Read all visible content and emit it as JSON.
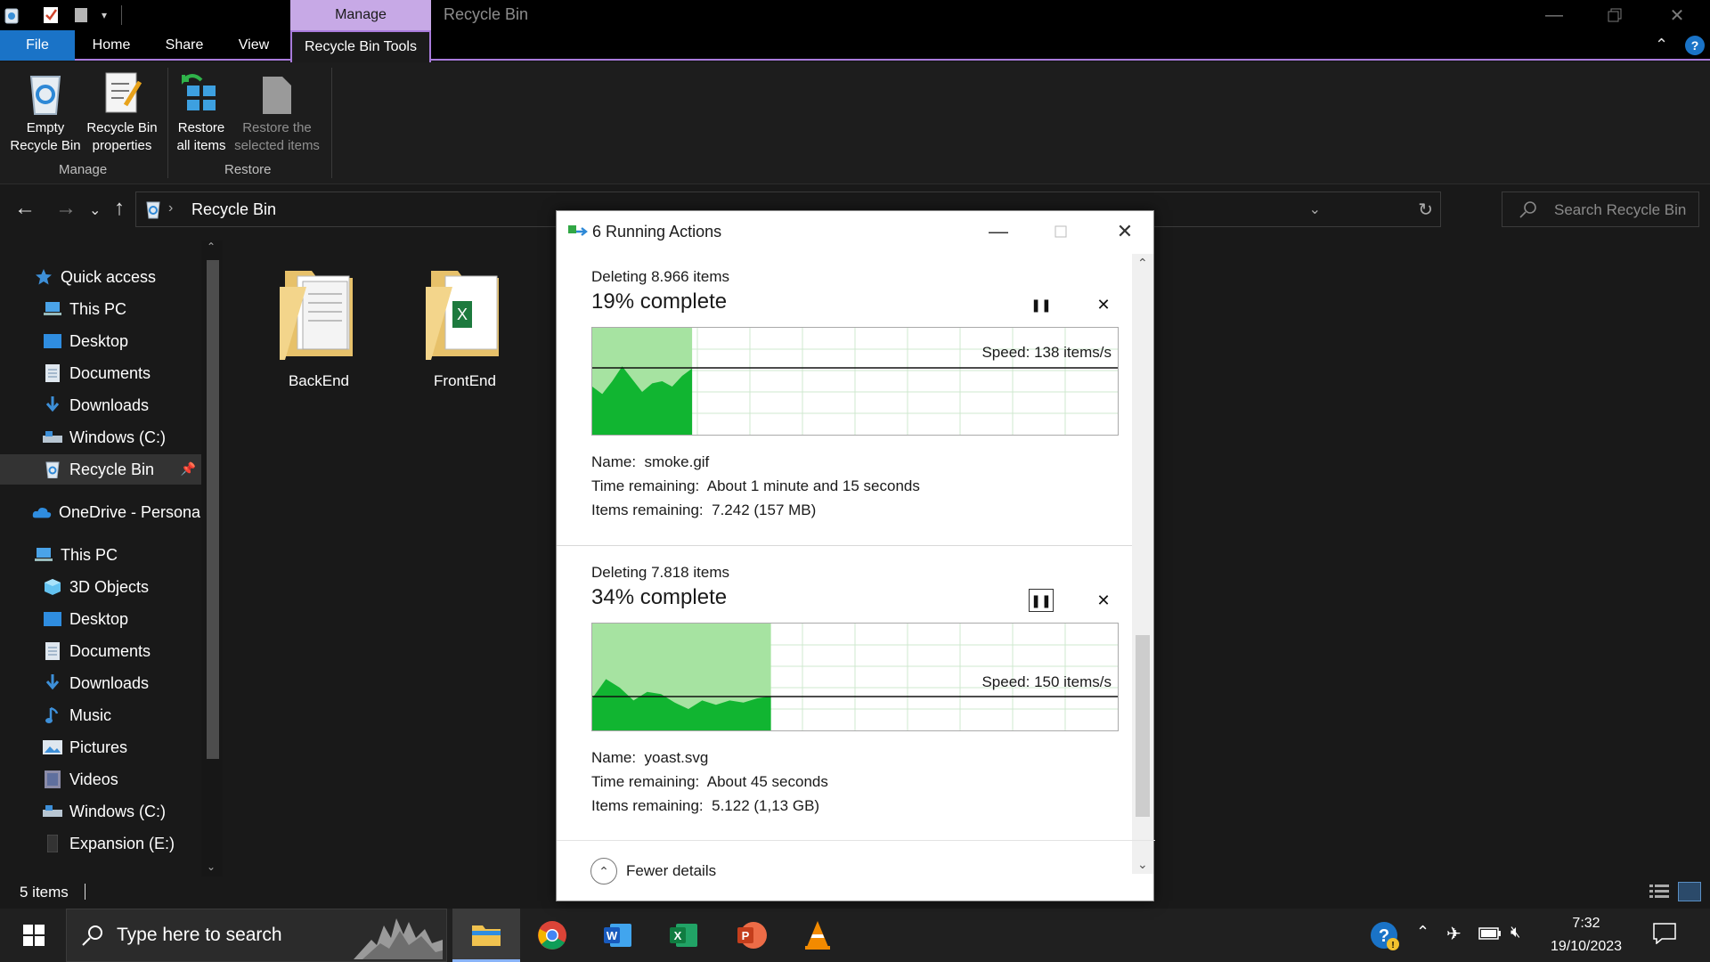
{
  "titlebar": {
    "manage_tab": "Manage",
    "window_title": "Recycle Bin"
  },
  "ribbon_tabs": [
    "File",
    "Home",
    "Share",
    "View",
    "Recycle Bin Tools"
  ],
  "ribbon": {
    "empty_bin": [
      "Empty",
      "Recycle Bin"
    ],
    "properties": [
      "Recycle Bin",
      "properties"
    ],
    "restore_all": [
      "Restore",
      "all items"
    ],
    "restore_selected": [
      "Restore the",
      "selected items"
    ],
    "group_manage": "Manage",
    "group_restore": "Restore"
  },
  "address": {
    "location": "Recycle Bin",
    "search_placeholder": "Search Recycle Bin"
  },
  "nav": {
    "quick_access": "Quick access",
    "quick_items": [
      "This PC",
      "Desktop",
      "Documents",
      "Downloads",
      "Windows (C:)",
      "Recycle Bin"
    ],
    "onedrive": "OneDrive - Personal",
    "this_pc": "This PC",
    "pc_items": [
      "3D Objects",
      "Desktop",
      "Documents",
      "Downloads",
      "Music",
      "Pictures",
      "Videos",
      "Windows (C:)",
      "Expansion (E:)"
    ]
  },
  "content": {
    "folders": [
      "BackEnd",
      "FrontEnd"
    ]
  },
  "status": {
    "item_count": "5 items"
  },
  "taskbar": {
    "search_placeholder": "Type here to search",
    "time": "7:32",
    "date": "19/10/2023"
  },
  "dialog": {
    "title": "6 Running Actions",
    "fewer_details": "Fewer details",
    "operations": [
      {
        "heading": "Deleting 8.966 items",
        "percent_text": "19% complete",
        "progress": 0.19,
        "speed": "Speed: 138 items/s",
        "name_label": "Name:",
        "name": "smoke.gif",
        "time_label": "Time remaining:",
        "time": "About 1 minute and 15 seconds",
        "items_label": "Items remaining:",
        "items": "7.242 (157 MB)"
      },
      {
        "heading": "Deleting 7.818 items",
        "percent_text": "34% complete",
        "progress": 0.34,
        "speed": "Speed: 150 items/s",
        "name_label": "Name:",
        "name": "yoast.svg",
        "time_label": "Time remaining:",
        "time": "About 45 seconds",
        "items_label": "Items remaining:",
        "items": "5.122 (1,13 GB)"
      }
    ]
  },
  "colors": {
    "accent": "#1a73c7",
    "manage_tab": "#c7a9e6",
    "graph_light": "#a6e3a1",
    "graph_dark": "#11b531"
  }
}
